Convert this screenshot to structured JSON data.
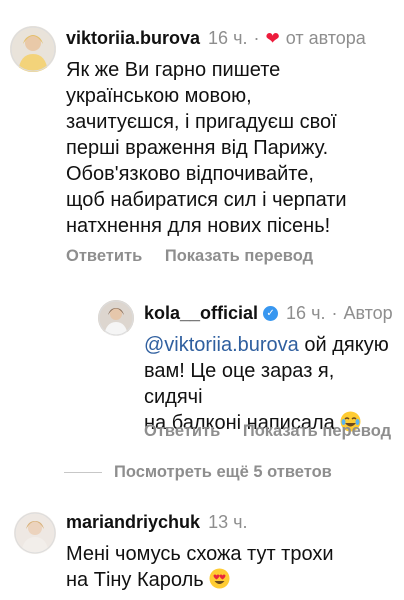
{
  "comments": [
    {
      "username": "viktoriia.burova",
      "time": "16 ч.",
      "dot": "·",
      "heart_icon": "❤",
      "author_label": "от автора",
      "lines": [
        "Як же Ви гарно пишете",
        "українською мовою,",
        "зачитуєшся, і пригадуєш свої",
        "перші враження від Парижу.",
        "Обов'язково відпочивайте,",
        "щоб набиратися сил і черпати",
        "натхнення для нових пісень!"
      ],
      "reply_label": "Ответить",
      "translate_label": "Показать перевод"
    },
    {
      "username": "kola__official",
      "verified_icon": "✓",
      "time": "16 ч.",
      "dot": "·",
      "author_label": "Автор",
      "mention": "@viktoriia.burova",
      "line1_rest": " ой дякую",
      "line2": "вам! Це оце зараз я, сидячі",
      "line3": "на балконі написала ",
      "reply_label": "Ответить",
      "translate_label": "Показать перевод"
    },
    {
      "username": "mariandriychuk",
      "time": "13 ч.",
      "line1": "Мені чомусь схожа тут трохи",
      "line2": "на Тіну Кароль"
    }
  ],
  "more_replies_label": "Посмотреть ещё 5 ответов",
  "colors": {
    "accent_heart": "#ed1c3c",
    "mention": "#2f5f9f",
    "muted": "#8e8e8e"
  }
}
